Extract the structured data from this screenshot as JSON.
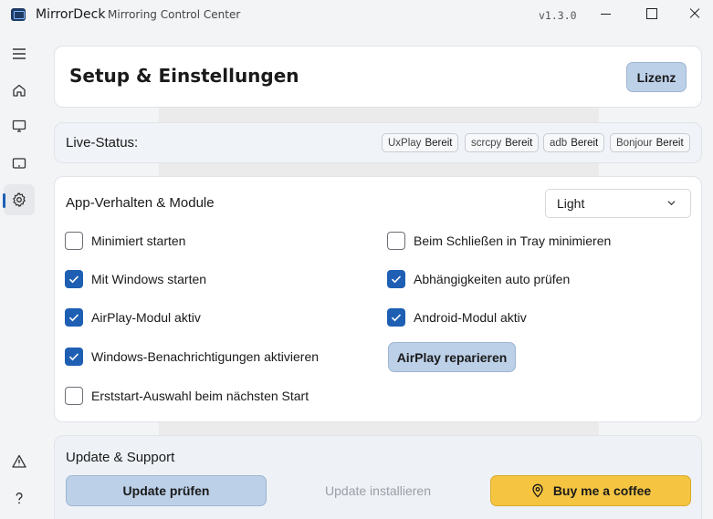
{
  "app": {
    "name": "MirrorDeck",
    "subtitle": "Mirroring Control Center",
    "version": "v1.3.0"
  },
  "sidebar": {
    "items": [
      {
        "icon": "hamburger-menu-icon",
        "active": false
      },
      {
        "icon": "home-icon",
        "active": false
      },
      {
        "icon": "monitor-icon",
        "active": false
      },
      {
        "icon": "tablet-icon",
        "active": false
      },
      {
        "icon": "gear-icon",
        "active": true
      }
    ],
    "bottom": [
      {
        "icon": "warning-icon"
      },
      {
        "icon": "help-icon"
      }
    ]
  },
  "header": {
    "title": "Setup & Einstellungen",
    "license_label": "Lizenz"
  },
  "status": {
    "label": "Live-Status:",
    "services": [
      {
        "name": "UxPlay",
        "state": "Bereit"
      },
      {
        "name": "scrcpy",
        "state": "Bereit"
      },
      {
        "name": "adb",
        "state": "Bereit"
      },
      {
        "name": "Bonjour",
        "state": "Bereit"
      }
    ]
  },
  "behavior": {
    "title": "App-Verhalten & Module",
    "theme_selected": "Light",
    "options": {
      "start_minimized": {
        "label": "Minimiert starten",
        "checked": false
      },
      "tray_on_close": {
        "label": "Beim Schließen in Tray minimieren",
        "checked": false
      },
      "start_with_windows": {
        "label": "Mit Windows starten",
        "checked": true
      },
      "check_dependencies": {
        "label": "Abhängigkeiten auto prüfen",
        "checked": true
      },
      "airplay_module": {
        "label": "AirPlay-Modul aktiv",
        "checked": true
      },
      "android_module": {
        "label": "Android-Modul aktiv",
        "checked": true
      },
      "windows_notifications": {
        "label": "Windows-Benachrichtigungen aktivieren",
        "checked": true
      },
      "first_start_selection": {
        "label": "Erststart-Auswahl beim nächsten Start",
        "checked": false
      }
    },
    "repair_airplay_label": "AirPlay reparieren"
  },
  "update": {
    "title": "Update & Support",
    "check_label": "Update prüfen",
    "install_label": "Update installieren",
    "coffee_label": "Buy me a coffee"
  },
  "colors": {
    "accent": "#1e5fb4",
    "button_blue": "#bcd0e8",
    "coffee_yellow": "#f5c542"
  }
}
